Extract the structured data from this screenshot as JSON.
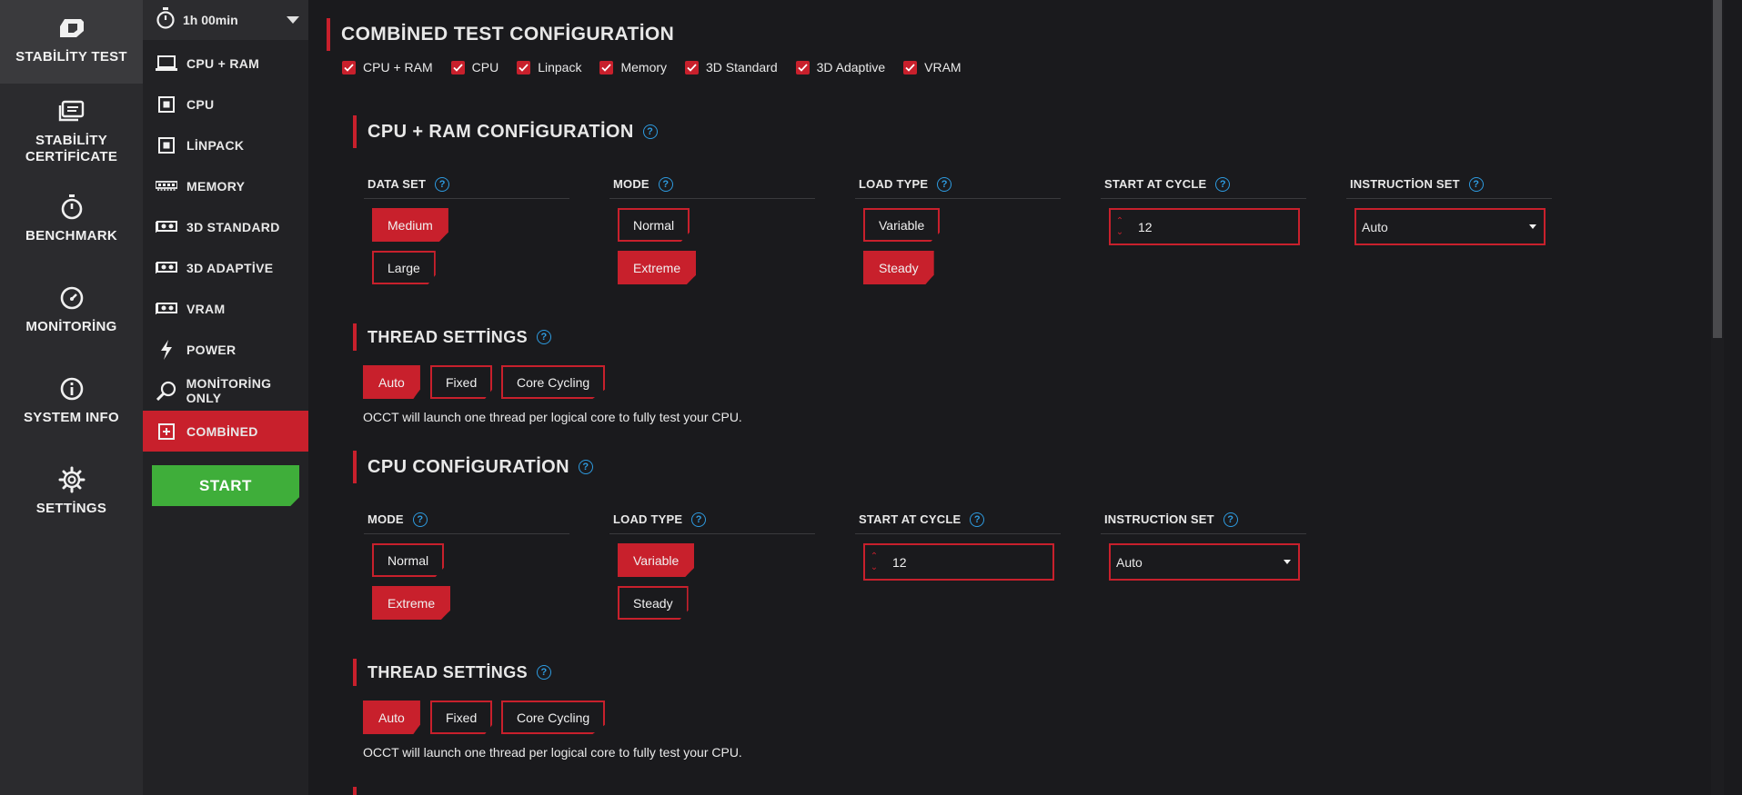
{
  "colors": {
    "accent": "#c8202c",
    "start_green": "#3fae3a",
    "help_blue": "#2e9be0"
  },
  "rail": [
    {
      "icon": "occt-logo-icon",
      "label": "STABİLİTY TEST",
      "active": true
    },
    {
      "icon": "certificate-icon",
      "label": "STABİLİTY CERTİFİCATE"
    },
    {
      "icon": "stopwatch-icon",
      "label": "BENCHMARK"
    },
    {
      "icon": "gauge-icon",
      "label": "MONİTORİNG"
    },
    {
      "icon": "info-icon",
      "label": "SYSTEM INFO"
    },
    {
      "icon": "gear-icon",
      "label": "SETTİNGS"
    }
  ],
  "submenu": {
    "timer": "1h 00min",
    "items": [
      {
        "icon": "laptop-icon",
        "label": "CPU + RAM"
      },
      {
        "icon": "cpu-chip-icon",
        "label": "CPU"
      },
      {
        "icon": "cpu-chip-icon",
        "label": "LİNPACK"
      },
      {
        "icon": "memory-icon",
        "label": "MEMORY"
      },
      {
        "icon": "gpu-icon",
        "label": "3D STANDARD"
      },
      {
        "icon": "gpu-icon",
        "label": "3D ADAPTİVE"
      },
      {
        "icon": "gpu-icon",
        "label": "VRAM"
      },
      {
        "icon": "lightning-icon",
        "label": "POWER"
      },
      {
        "icon": "magnifier-icon",
        "label": "MONİTORİNG ONLY"
      },
      {
        "icon": "plus-box-icon",
        "label": "COMBİNED",
        "active": true
      }
    ],
    "start_label": "START"
  },
  "main": {
    "title": "COMBİNED TEST CONFİGURATİON",
    "checks": [
      "CPU + RAM",
      "CPU",
      "Linpack",
      "Memory",
      "3D Standard",
      "3D Adaptive",
      "VRAM"
    ],
    "cpuram": {
      "title": "CPU + RAM CONFİGURATİON",
      "dataset_head": "DATA SET",
      "dataset_opts": [
        "Medium",
        "Large"
      ],
      "mode_head": "MODE",
      "mode_opts": [
        "Normal",
        "Extreme"
      ],
      "load_head": "LOAD TYPE",
      "load_opts": [
        "Variable",
        "Steady"
      ],
      "cycle_head": "START AT CYCLE",
      "cycle_value": "12",
      "instr_head": "INSTRUCTİON SET",
      "instr_value": "Auto",
      "thread_title": "THREAD SETTİNGS",
      "thread_opts": [
        "Auto",
        "Fixed",
        "Core Cycling"
      ],
      "thread_desc": "OCCT will launch one thread per logical core to fully test your CPU."
    },
    "cpu": {
      "title": "CPU CONFİGURATİON",
      "mode_head": "MODE",
      "mode_opts": [
        "Normal",
        "Extreme"
      ],
      "load_head": "LOAD TYPE",
      "load_opts": [
        "Variable",
        "Steady"
      ],
      "cycle_head": "START AT CYCLE",
      "cycle_value": "12",
      "instr_head": "INSTRUCTİON SET",
      "instr_value": "Auto",
      "thread_title": "THREAD SETTİNGS",
      "thread_opts": [
        "Auto",
        "Fixed",
        "Core Cycling"
      ],
      "thread_desc": "OCCT will launch one thread per logical core to fully test your CPU."
    }
  }
}
